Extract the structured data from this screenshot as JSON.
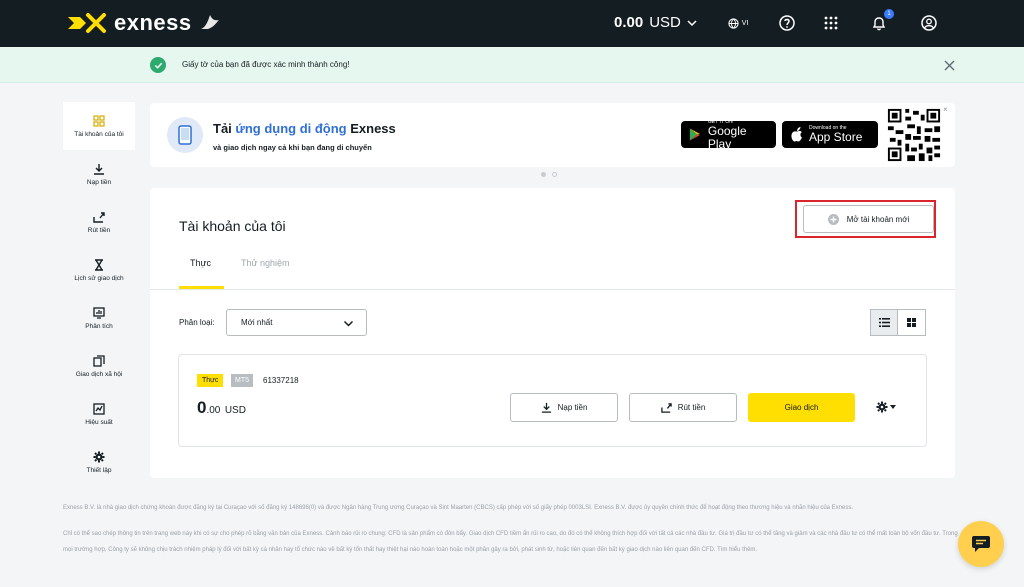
{
  "header": {
    "brand": "exness",
    "balance_value": "0.00",
    "balance_currency": "USD",
    "language": "VI",
    "notification_count": "1"
  },
  "notice": {
    "text": "Giấy tờ của bạn đã được xác minh thành công!"
  },
  "sidebar": {
    "items": [
      {
        "label": "Tài khoản của tôi",
        "icon": "grid-icon",
        "active": true
      },
      {
        "label": "Nạp tiền",
        "icon": "download-icon"
      },
      {
        "label": "Rút tiền",
        "icon": "upload-icon"
      },
      {
        "label": "Lịch sử giao dịch",
        "icon": "hourglass-icon"
      },
      {
        "label": "Phân tích",
        "icon": "chart-icon"
      },
      {
        "label": "Giao dịch xã hội",
        "icon": "copy-icon"
      },
      {
        "label": "Hiệu suất",
        "icon": "performance-icon"
      },
      {
        "label": "Thiết lập",
        "icon": "gear-icon"
      }
    ]
  },
  "promo": {
    "title_prefix": "Tải ",
    "title_highlight": "ứng dụng di động",
    "title_suffix": " Exness",
    "subtitle": "và giao dịch ngay cả khi bạn đang di chuyển",
    "google_small": "GET IT ON",
    "google_big": "Google Play",
    "apple_small": "Download on the",
    "apple_big": "App Store",
    "close": "×"
  },
  "accounts": {
    "title": "Tài khoản của tôi",
    "open_button": "Mở tài khoản mới",
    "tabs": [
      "Thực",
      "Thử nghiệm"
    ],
    "filter_label": "Phân loại:",
    "filter_value": "Mới nhất",
    "card": {
      "type": "Thực",
      "platform": "MT5",
      "number": "61337218",
      "balance_int": "0",
      "balance_dec": ".00",
      "currency": "USD",
      "deposit": "Nạp tiền",
      "withdraw": "Rút tiền",
      "trade": "Giao dịch"
    }
  },
  "footer": {
    "p1": "Exness B.V. là nhà giao dịch chứng khoán được đăng ký tại Curaçao với số đăng ký 148698(0) và được Ngân hàng Trung ương Curaçao và Sint Maarten (CBCS) cấp phép với số giấy phép 0003LSI. Exness B.V. được ủy quyền chính thức để hoạt động theo thương hiệu và nhãn hiệu của Exness.",
    "p2": "Chỉ có thể sao chép thông tin trên trang web này khi có sự cho phép rõ bằng văn bản của Exness. Cảnh báo rủi ro chung: CFD là sản phẩm có đòn bẩy. Giao dịch CFD tiềm ẩn rủi ro cao, do đó có thể không thích hợp đối với tất cả các nhà đầu tư. Giá trị đầu tư có thể tăng và giảm và các nhà đầu tư có thể mất toàn bộ vốn đầu tư. Trong mọi trường hợp, Công ty sẽ không chịu trách nhiệm pháp lý đối với bất kỳ cá nhân hay tổ chức nào về bất kỳ tổn thất hay thiệt hại nào hoàn toàn hoặc một phần gây ra bởi, phát sinh từ, hoặc liên quan đến bất kỳ giao dịch nào liên quan đến CFD. Tìm hiểu thêm."
  },
  "colors": {
    "header_bg": "#141d22",
    "accent_yellow": "#ffde02",
    "success_green": "#2faa6f",
    "link_blue": "#2f6fd6",
    "highlight_red": "#d9262c"
  }
}
